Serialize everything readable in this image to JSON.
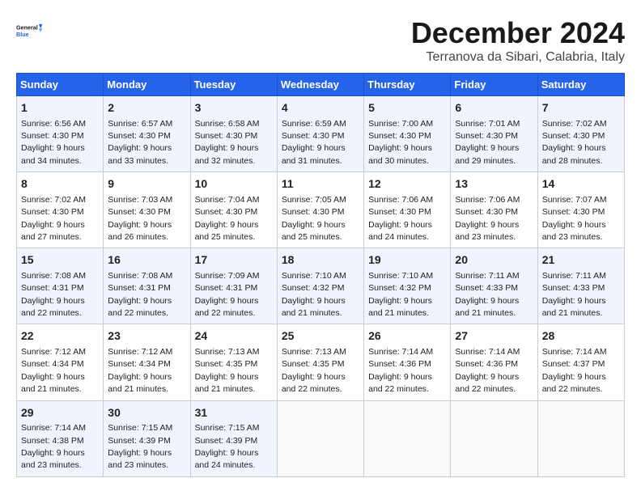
{
  "header": {
    "logo_line1": "General",
    "logo_line2": "Blue",
    "month": "December 2024",
    "location": "Terranova da Sibari, Calabria, Italy"
  },
  "weekdays": [
    "Sunday",
    "Monday",
    "Tuesday",
    "Wednesday",
    "Thursday",
    "Friday",
    "Saturday"
  ],
  "weeks": [
    [
      {
        "day": "1",
        "sunrise": "Sunrise: 6:56 AM",
        "sunset": "Sunset: 4:30 PM",
        "daylight": "Daylight: 9 hours and 34 minutes."
      },
      {
        "day": "2",
        "sunrise": "Sunrise: 6:57 AM",
        "sunset": "Sunset: 4:30 PM",
        "daylight": "Daylight: 9 hours and 33 minutes."
      },
      {
        "day": "3",
        "sunrise": "Sunrise: 6:58 AM",
        "sunset": "Sunset: 4:30 PM",
        "daylight": "Daylight: 9 hours and 32 minutes."
      },
      {
        "day": "4",
        "sunrise": "Sunrise: 6:59 AM",
        "sunset": "Sunset: 4:30 PM",
        "daylight": "Daylight: 9 hours and 31 minutes."
      },
      {
        "day": "5",
        "sunrise": "Sunrise: 7:00 AM",
        "sunset": "Sunset: 4:30 PM",
        "daylight": "Daylight: 9 hours and 30 minutes."
      },
      {
        "day": "6",
        "sunrise": "Sunrise: 7:01 AM",
        "sunset": "Sunset: 4:30 PM",
        "daylight": "Daylight: 9 hours and 29 minutes."
      },
      {
        "day": "7",
        "sunrise": "Sunrise: 7:02 AM",
        "sunset": "Sunset: 4:30 PM",
        "daylight": "Daylight: 9 hours and 28 minutes."
      }
    ],
    [
      {
        "day": "8",
        "sunrise": "Sunrise: 7:02 AM",
        "sunset": "Sunset: 4:30 PM",
        "daylight": "Daylight: 9 hours and 27 minutes."
      },
      {
        "day": "9",
        "sunrise": "Sunrise: 7:03 AM",
        "sunset": "Sunset: 4:30 PM",
        "daylight": "Daylight: 9 hours and 26 minutes."
      },
      {
        "day": "10",
        "sunrise": "Sunrise: 7:04 AM",
        "sunset": "Sunset: 4:30 PM",
        "daylight": "Daylight: 9 hours and 25 minutes."
      },
      {
        "day": "11",
        "sunrise": "Sunrise: 7:05 AM",
        "sunset": "Sunset: 4:30 PM",
        "daylight": "Daylight: 9 hours and 25 minutes."
      },
      {
        "day": "12",
        "sunrise": "Sunrise: 7:06 AM",
        "sunset": "Sunset: 4:30 PM",
        "daylight": "Daylight: 9 hours and 24 minutes."
      },
      {
        "day": "13",
        "sunrise": "Sunrise: 7:06 AM",
        "sunset": "Sunset: 4:30 PM",
        "daylight": "Daylight: 9 hours and 23 minutes."
      },
      {
        "day": "14",
        "sunrise": "Sunrise: 7:07 AM",
        "sunset": "Sunset: 4:30 PM",
        "daylight": "Daylight: 9 hours and 23 minutes."
      }
    ],
    [
      {
        "day": "15",
        "sunrise": "Sunrise: 7:08 AM",
        "sunset": "Sunset: 4:31 PM",
        "daylight": "Daylight: 9 hours and 22 minutes."
      },
      {
        "day": "16",
        "sunrise": "Sunrise: 7:08 AM",
        "sunset": "Sunset: 4:31 PM",
        "daylight": "Daylight: 9 hours and 22 minutes."
      },
      {
        "day": "17",
        "sunrise": "Sunrise: 7:09 AM",
        "sunset": "Sunset: 4:31 PM",
        "daylight": "Daylight: 9 hours and 22 minutes."
      },
      {
        "day": "18",
        "sunrise": "Sunrise: 7:10 AM",
        "sunset": "Sunset: 4:32 PM",
        "daylight": "Daylight: 9 hours and 21 minutes."
      },
      {
        "day": "19",
        "sunrise": "Sunrise: 7:10 AM",
        "sunset": "Sunset: 4:32 PM",
        "daylight": "Daylight: 9 hours and 21 minutes."
      },
      {
        "day": "20",
        "sunrise": "Sunrise: 7:11 AM",
        "sunset": "Sunset: 4:33 PM",
        "daylight": "Daylight: 9 hours and 21 minutes."
      },
      {
        "day": "21",
        "sunrise": "Sunrise: 7:11 AM",
        "sunset": "Sunset: 4:33 PM",
        "daylight": "Daylight: 9 hours and 21 minutes."
      }
    ],
    [
      {
        "day": "22",
        "sunrise": "Sunrise: 7:12 AM",
        "sunset": "Sunset: 4:34 PM",
        "daylight": "Daylight: 9 hours and 21 minutes."
      },
      {
        "day": "23",
        "sunrise": "Sunrise: 7:12 AM",
        "sunset": "Sunset: 4:34 PM",
        "daylight": "Daylight: 9 hours and 21 minutes."
      },
      {
        "day": "24",
        "sunrise": "Sunrise: 7:13 AM",
        "sunset": "Sunset: 4:35 PM",
        "daylight": "Daylight: 9 hours and 21 minutes."
      },
      {
        "day": "25",
        "sunrise": "Sunrise: 7:13 AM",
        "sunset": "Sunset: 4:35 PM",
        "daylight": "Daylight: 9 hours and 22 minutes."
      },
      {
        "day": "26",
        "sunrise": "Sunrise: 7:14 AM",
        "sunset": "Sunset: 4:36 PM",
        "daylight": "Daylight: 9 hours and 22 minutes."
      },
      {
        "day": "27",
        "sunrise": "Sunrise: 7:14 AM",
        "sunset": "Sunset: 4:36 PM",
        "daylight": "Daylight: 9 hours and 22 minutes."
      },
      {
        "day": "28",
        "sunrise": "Sunrise: 7:14 AM",
        "sunset": "Sunset: 4:37 PM",
        "daylight": "Daylight: 9 hours and 22 minutes."
      }
    ],
    [
      {
        "day": "29",
        "sunrise": "Sunrise: 7:14 AM",
        "sunset": "Sunset: 4:38 PM",
        "daylight": "Daylight: 9 hours and 23 minutes."
      },
      {
        "day": "30",
        "sunrise": "Sunrise: 7:15 AM",
        "sunset": "Sunset: 4:39 PM",
        "daylight": "Daylight: 9 hours and 23 minutes."
      },
      {
        "day": "31",
        "sunrise": "Sunrise: 7:15 AM",
        "sunset": "Sunset: 4:39 PM",
        "daylight": "Daylight: 9 hours and 24 minutes."
      },
      null,
      null,
      null,
      null
    ]
  ]
}
